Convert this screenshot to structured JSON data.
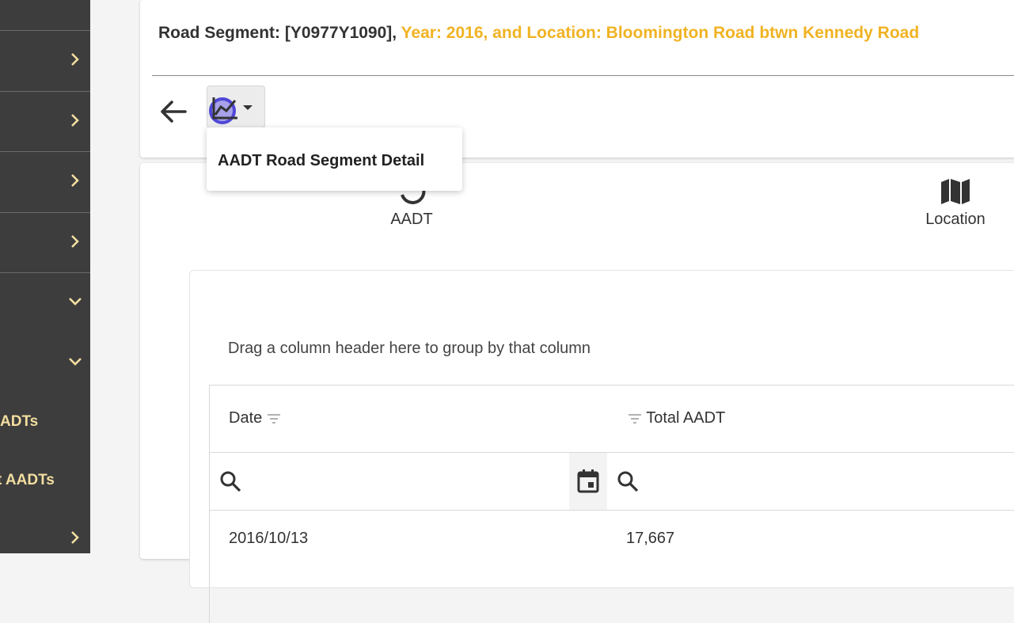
{
  "sidebar": {
    "items": [
      {
        "icon": "chevron-right-icon"
      },
      {
        "icon": "chevron-right-icon"
      },
      {
        "icon": "chevron-right-icon"
      },
      {
        "icon": "chevron-right-icon"
      },
      {
        "icon": "chevron-down-icon"
      },
      {
        "icon": "chevron-down-icon"
      },
      {
        "label": "ADTs"
      },
      {
        "label": "t AADTs"
      },
      {
        "icon": "chevron-right-icon"
      }
    ],
    "background": "#3d3d3d",
    "text_color": "#f3dea0"
  },
  "header": {
    "title_main": "Road Segment: [Y0977Y1090],",
    "title_accent": "Year: 2016, and Location: Bloomington Road btwn Kennedy Road",
    "accent_color": "#f0b323"
  },
  "toolbar": {
    "back_icon": "arrow-left-icon",
    "chart_icon": "line-chart-icon",
    "menu_item": "AADT Road Segment Detail"
  },
  "tabs": [
    {
      "label": "AADT",
      "icon": "history-icon"
    },
    {
      "label": "Location",
      "icon": "map-icon"
    }
  ],
  "grid": {
    "group_hint": "Drag a column header here to group by that column",
    "columns": [
      "Date",
      "Total AADT"
    ],
    "rows": [
      {
        "date": "2016/10/13",
        "total": "17,667"
      }
    ]
  }
}
